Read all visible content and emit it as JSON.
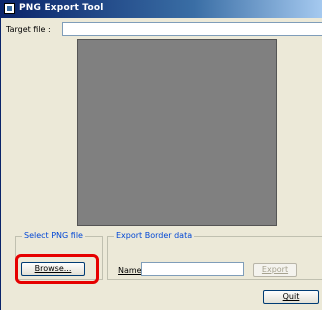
{
  "window": {
    "title": "PNG Export Tool"
  },
  "target": {
    "label": "Target file :",
    "value": ""
  },
  "select_png": {
    "legend": "Select PNG file",
    "browse_label": "Browse..."
  },
  "export_border": {
    "legend": "Export Border data",
    "name_label": "Name",
    "name_value": "",
    "export_label": "Export"
  },
  "footer": {
    "quit_label": "Quit"
  },
  "colors": {
    "titlebar": "#0a246a",
    "window_bg": "#ece9d8",
    "preview": "#808080",
    "highlight": "#e60000",
    "group_text": "#0046d5"
  }
}
